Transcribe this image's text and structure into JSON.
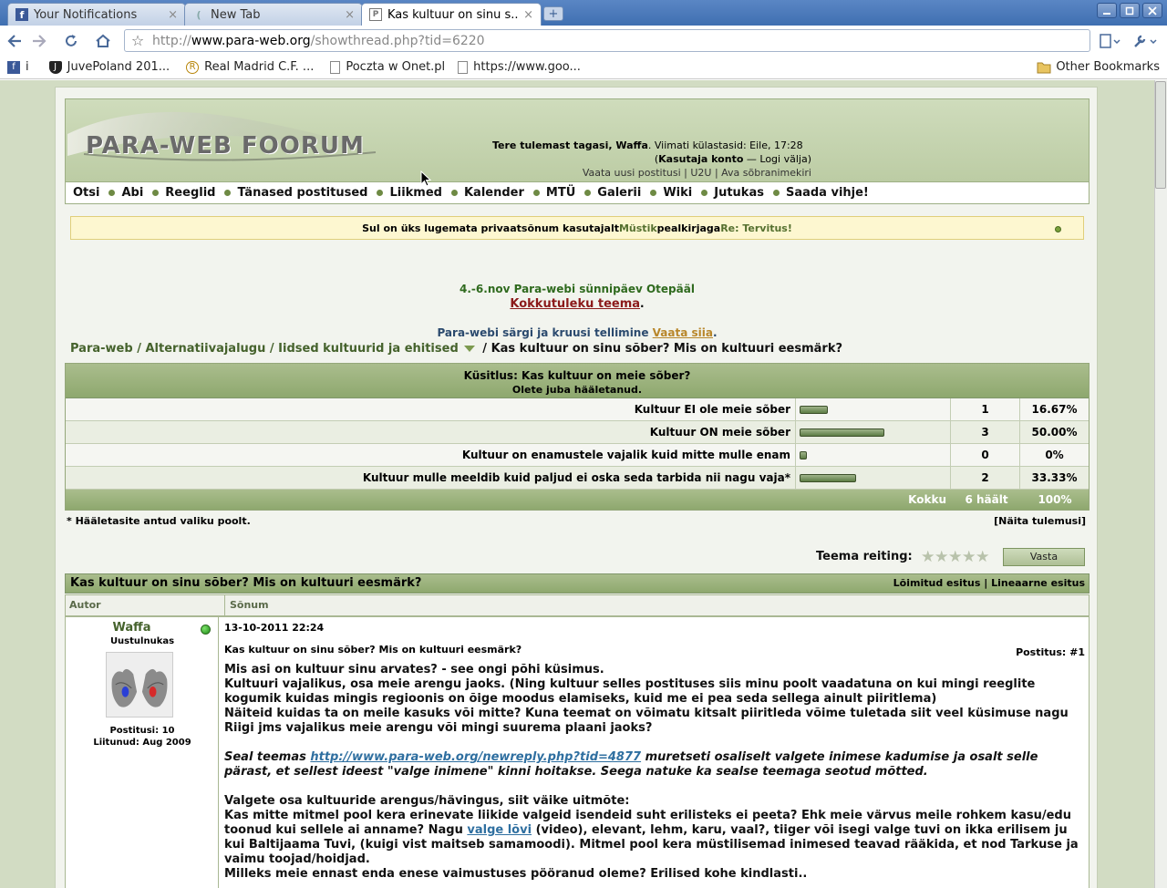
{
  "browser": {
    "tabs": [
      {
        "label": "Your Notifications",
        "icon": "f"
      },
      {
        "label": "New Tab",
        "icon": "("
      },
      {
        "label": "Kas kultuur on sinu s...",
        "icon": "P"
      }
    ],
    "close_glyph": "×",
    "newtab_glyph": "+",
    "url_prefix": "http://",
    "url_host": "www.para-web.org",
    "url_path": "/showthread.php?tid=6220",
    "bookmarks": [
      {
        "label": "i",
        "icon": "f"
      },
      {
        "label": "JuvePoland 201...",
        "icon": "J"
      },
      {
        "label": "Real Madrid C.F. ...",
        "icon": "R"
      },
      {
        "label": "Poczta w Onet.pl",
        "icon": ""
      },
      {
        "label": "https://www.goo...",
        "icon": ""
      }
    ],
    "other_bookmarks": "Other Bookmarks"
  },
  "forum": {
    "logo": "PARA-WEB FOORUM",
    "welcome_prefix": "Tere tulemast tagasi, ",
    "welcome_user": "Waffa",
    "welcome_suffix": ". Viimati külastasid: Eile, 17:28",
    "account_link": "Kasutaja konto",
    "logout_link": "— Logi välja",
    "account_open": "(",
    "account_close": ")",
    "quick_links": "Vaata uusi postitusi | U2U | Ava sõbranimekiri",
    "nav": [
      "Otsi",
      "Abi",
      "Reeglid",
      "Tänased postitused",
      "Liikmed",
      "Kalender",
      "MTÜ",
      "Galerii",
      "Wiki",
      "Jutukas",
      "Saada vihje!"
    ],
    "pm_prefix": "Sul on üks lugemata privaatsõnum kasutajalt ",
    "pm_user": "Müstik",
    "pm_mid": " pealkirjaga ",
    "pm_subject": "Re: Tervitus!",
    "announce1": "4.-6.nov Para-webi sünnipäev Otepääl",
    "announce1_link": "Kokkutuleku teema",
    "announce2": "Para-webi särgi ja kruusi tellimine ",
    "announce2_link": "Vaata siia",
    "period": ".",
    "breadcrumb": [
      "Para-web",
      "Alternatiivajalugu",
      "Iidsed kultuurid ja ehitised"
    ],
    "breadcrumb_sep": " / ",
    "breadcrumb_current": "Kas kultuur on sinu sõber? Mis on kultuuri eesmärk?"
  },
  "poll": {
    "title": "Küsitlus: Kas kultuur on meie sõber?",
    "subtitle": "Olete juba hääletanud.",
    "options": [
      {
        "label": "Kultuur EI ole meie sõber",
        "votes": "1",
        "percent": "16.67%",
        "share": 0.1667
      },
      {
        "label": "Kultuur ON meie sõber",
        "votes": "3",
        "percent": "50.00%",
        "share": 0.5
      },
      {
        "label": "Kultuur on enamustele vajalik kuid mitte mulle enam",
        "votes": "0",
        "percent": "0%",
        "share": 0
      },
      {
        "label": "Kultuur mulle meeldib kuid paljud ei oska seda tarbida nii nagu vaja*",
        "votes": "2",
        "percent": "33.33%",
        "share": 0.3333
      }
    ],
    "total_label": "Kokku",
    "total_votes": "6 häält",
    "total_percent": "100%",
    "note": "* Hääletasite antud valiku poolt.",
    "show_results": "[Näita tulemusi]"
  },
  "thread": {
    "rating_label": "Teema reiting:",
    "reply_button": "Vasta",
    "title": "Kas kultuur on sinu sõber? Mis on kultuuri eesmärk?",
    "view_modes": "Lõimitud esitus | Lineaarne esitus",
    "col_author": "Autor",
    "col_message": "Sõnum",
    "post": {
      "author": "Waffa",
      "author_title": "Uustulnukas",
      "posts": "Postitusi: 10",
      "joined": "Liitunud: Aug 2009",
      "date": "13-10-2011 22:24",
      "title": "Kas kultuur on sinu sõber? Mis on kultuuri eesmärk?",
      "number": "Postitus: #1",
      "p1_l1": "Mis asi on kultuur sinu arvates? - see ongi põhi küsimus.",
      "p1_l2": "Kultuuri vajalikus, osa meie arengu jaoks. (Ning kultuur selles postituses siis minu poolt vaadatuna on kui mingi reeglite kogumik kuidas mingis regioonis on õige moodus elamiseks, kuid me ei pea seda sellega ainult piiritlema)",
      "p1_l3": "Näiteid kuidas ta on meile kasuks või mitte? Kuna teemat on võimatu kitsalt piiritleda võime tuletada siit veel küsimuse nagu Riigi jms vajalikus meie arengu või mingi suurema plaani jaoks?",
      "p2_pre": "Seal teemas ",
      "p2_link": "http://www.para-web.org/newreply.php?tid=4877",
      "p2_post": " muretseti osaliselt valgete inimese kadumise ja osalt selle pärast, et sellest ideest \"valge inimene\" kinni hoitakse. Seega natuke ka sealse teemaga seotud mõtted.",
      "p3_l1": "Valgete osa kultuuride arengus/hävingus, siit väike uitmõte:",
      "p3_pre": "Kas mitte mitmel pool kera erinevate liikide valgeid isendeid suht erilisteks ei peeta? Ehk meie värvus meile rohkem kasu/edu toonud kui sellele ai anname? Nagu ",
      "p3_link": "valge lõvi",
      "p3_post": " (video), elevant, lehm, karu, vaal?, tiiger või isegi valge tuvi on ikka erilisem ju kui Baltijaama Tuvi, (kuigi vist maitseb samamoodi). Mitmel pool kera müstilisemad inimesed teavad rääkida, et nod Tarkuse ja vaimu toojad/hoidjad.",
      "p3_l3": "Milleks meie ennast enda enese vaimustuses pööranud oleme? Erilised kohe kindlasti.."
    }
  },
  "colors": {
    "accent": "#8ea86e",
    "link": "#2f6fa0",
    "notice_bg": "#fdf7d0"
  }
}
